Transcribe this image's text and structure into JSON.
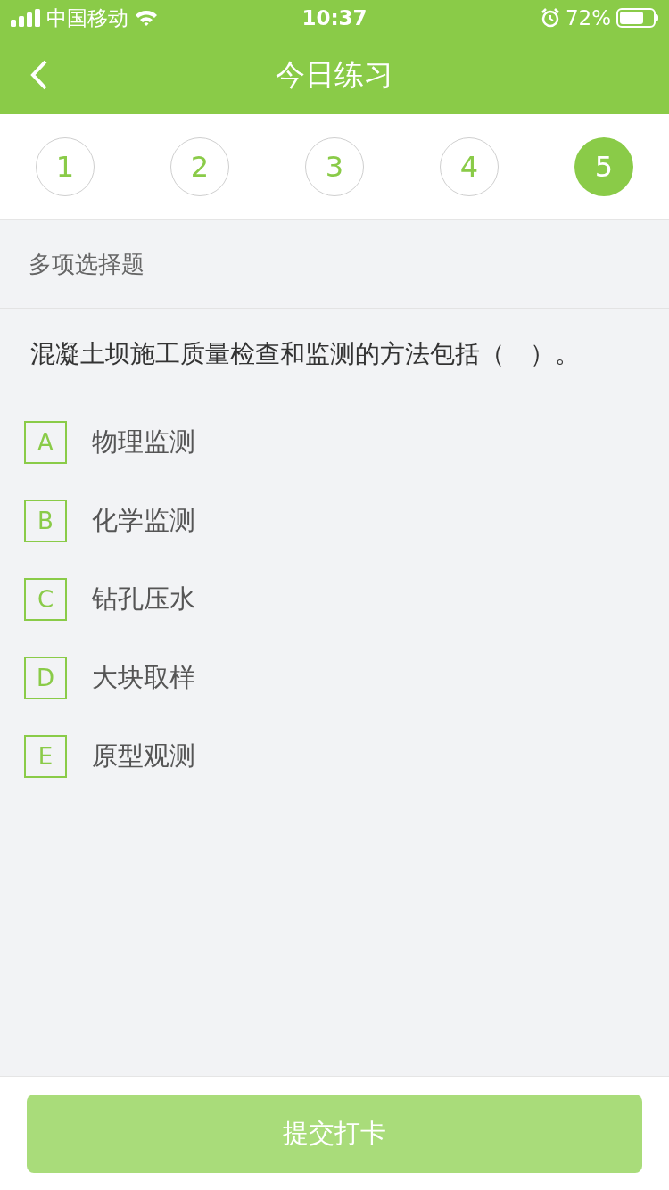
{
  "status_bar": {
    "carrier": "中国移动",
    "time": "10:37",
    "battery": "72%"
  },
  "header": {
    "title": "今日练习"
  },
  "steps": [
    {
      "label": "1",
      "selected": false
    },
    {
      "label": "2",
      "selected": false
    },
    {
      "label": "3",
      "selected": false
    },
    {
      "label": "4",
      "selected": false
    },
    {
      "label": "5",
      "selected": true
    }
  ],
  "question_type": "多项选择题",
  "question": "混凝土坝施工质量检查和监测的方法包括（　）。",
  "options": [
    {
      "letter": "A",
      "text": "物理监测",
      "checked": false
    },
    {
      "letter": "B",
      "text": "化学监测",
      "checked": false
    },
    {
      "letter": "C",
      "text": "钻孔压水",
      "checked": false
    },
    {
      "letter": "D",
      "text": "大块取样",
      "checked": false
    },
    {
      "letter": "E",
      "text": "原型观测",
      "checked": false
    }
  ],
  "submit": {
    "label": "提交打卡",
    "disabled": true
  }
}
